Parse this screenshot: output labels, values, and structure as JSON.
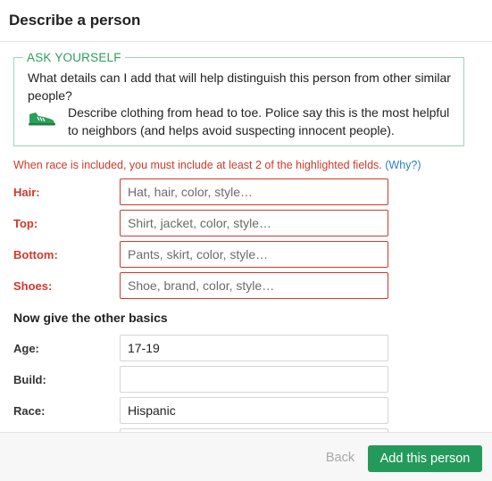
{
  "header": {
    "title": "Describe a person"
  },
  "ask_yourself": {
    "legend": "ASK YOURSELF",
    "question": "What details can I add that will help distinguish this person from other similar people?",
    "tip_icon": "sneaker-icon",
    "tip": "Describe clothing from head to toe. Police say this is the most helpful to neighbors (and helps avoid suspecting innocent people)."
  },
  "warning": {
    "text": "When race is included, you must include at least 2 of the highlighted fields.",
    "link": "(Why?)"
  },
  "highlighted_fields": [
    {
      "label": "Hair:",
      "placeholder": "Hat, hair, color, style…",
      "value": ""
    },
    {
      "label": "Top:",
      "placeholder": "Shirt, jacket, color, style…",
      "value": ""
    },
    {
      "label": "Bottom:",
      "placeholder": "Pants, skirt, color, style…",
      "value": ""
    },
    {
      "label": "Shoes:",
      "placeholder": "Shoe, brand, color, style…",
      "value": ""
    }
  ],
  "basics": {
    "title": "Now give the other basics",
    "fields": [
      {
        "label": "Age:",
        "value": "17-19"
      },
      {
        "label": "Build:",
        "value": ""
      },
      {
        "label": "Race:",
        "value": "Hispanic"
      }
    ]
  },
  "footer": {
    "back_label": "Back",
    "add_label": "Add this person"
  },
  "colors": {
    "accent_green": "#249a5a",
    "warning_red": "#d0392b",
    "link_blue": "#2b7fc3"
  }
}
